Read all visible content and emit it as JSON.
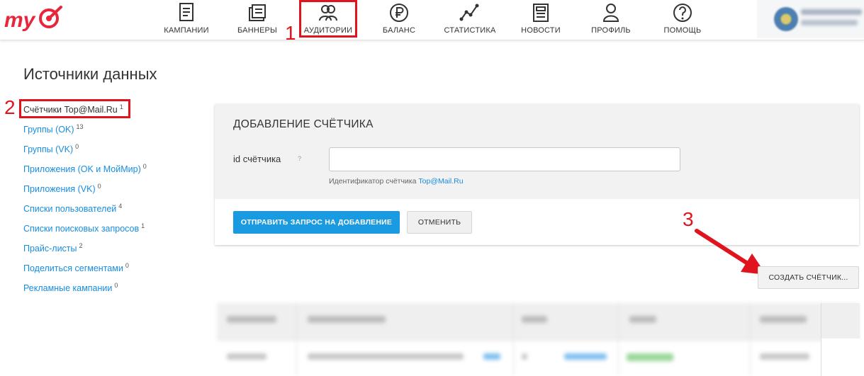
{
  "header": {
    "nav": [
      {
        "id": "campaigns",
        "label": "КАМПАНИИ",
        "icon": "campaigns-icon"
      },
      {
        "id": "banners",
        "label": "БАННЕРЫ",
        "icon": "banners-icon"
      },
      {
        "id": "audiences",
        "label": "АУДИТОРИИ",
        "icon": "audiences-icon",
        "active": true
      },
      {
        "id": "balance",
        "label": "БАЛАНС",
        "icon": "ruble-icon"
      },
      {
        "id": "statistics",
        "label": "СТАТИСТИКА",
        "icon": "statistics-icon"
      },
      {
        "id": "news",
        "label": "НОВОСТИ",
        "icon": "news-icon"
      },
      {
        "id": "profile",
        "label": "ПРОФИЛЬ",
        "icon": "profile-icon"
      },
      {
        "id": "help",
        "label": "ПОМОЩЬ",
        "icon": "help-icon"
      }
    ]
  },
  "annotations": {
    "step1": "1",
    "step2": "2",
    "step3": "3"
  },
  "page": {
    "title": "Источники данных"
  },
  "sidebar": {
    "items": [
      {
        "label": "Счётчики Top@Mail.Ru",
        "count": "1",
        "active": true
      },
      {
        "label": "Группы (OK)",
        "count": "13"
      },
      {
        "label": "Группы (VK)",
        "count": "0"
      },
      {
        "label": "Приложения (OK и МойМир)",
        "count": "0"
      },
      {
        "label": "Приложения (VK)",
        "count": "0"
      },
      {
        "label": "Списки пользователей",
        "count": "4"
      },
      {
        "label": "Списки поисковых запросов",
        "count": "1"
      },
      {
        "label": "Прайс-листы",
        "count": "2"
      },
      {
        "label": "Поделиться сегментами",
        "count": "0"
      },
      {
        "label": "Рекламные кампании",
        "count": "0"
      }
    ]
  },
  "form": {
    "title": "ДОБАВЛЕНИЕ СЧЁТЧИКА",
    "field_label": "id счётчика",
    "help_mark": "?",
    "input_value": "",
    "hint_prefix": "Идентификатор счётчика ",
    "hint_link": "Top@Mail.Ru",
    "submit_label": "ОТПРАВИТЬ ЗАПРОС НА ДОБАВЛЕНИЕ",
    "cancel_label": "ОТМЕНИТЬ"
  },
  "create_button_label": "СОЗДАТЬ СЧЁТЧИК...",
  "colors": {
    "accent": "#1a9ae0",
    "link": "#168de2",
    "annotation_red": "#e0141e",
    "logo_red": "#e8253a"
  }
}
